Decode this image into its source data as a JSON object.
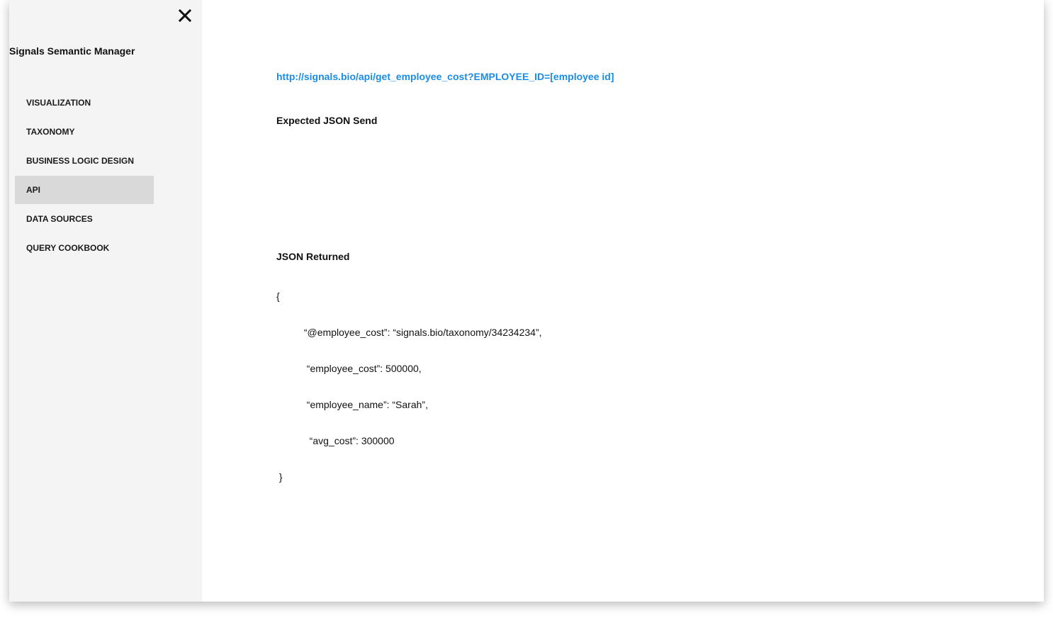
{
  "sidebar": {
    "app_title": "Signals Semantic Manager",
    "close_icon": "close-icon",
    "items": [
      {
        "label": "VISUALIZATION",
        "active": false
      },
      {
        "label": "TAXONOMY",
        "active": false
      },
      {
        "label": "BUSINESS LOGIC DESIGN",
        "active": false
      },
      {
        "label": "API",
        "active": true
      },
      {
        "label": "DATA SOURCES",
        "active": false
      },
      {
        "label": "QUERY COOKBOOK",
        "active": false
      }
    ]
  },
  "main": {
    "endpoint_url": "http://signals.bio/api/get_employee_cost?EMPLOYEE_ID=[employee id]",
    "expected_send_title": "Expected JSON Send",
    "returned_title": "JSON Returned",
    "json_lines": [
      "{",
      "          “@employee_cost”: “signals.bio/taxonomy/34234234”,",
      "           “employee_cost”: 500000,",
      "           “employee_name”: “Sarah”,",
      "            “avg_cost”: 300000",
      " }"
    ]
  },
  "colors": {
    "sidebar_bg": "#f4f4f4",
    "active_item_bg": "#d9d9d9",
    "link": "#1a8ce8"
  }
}
